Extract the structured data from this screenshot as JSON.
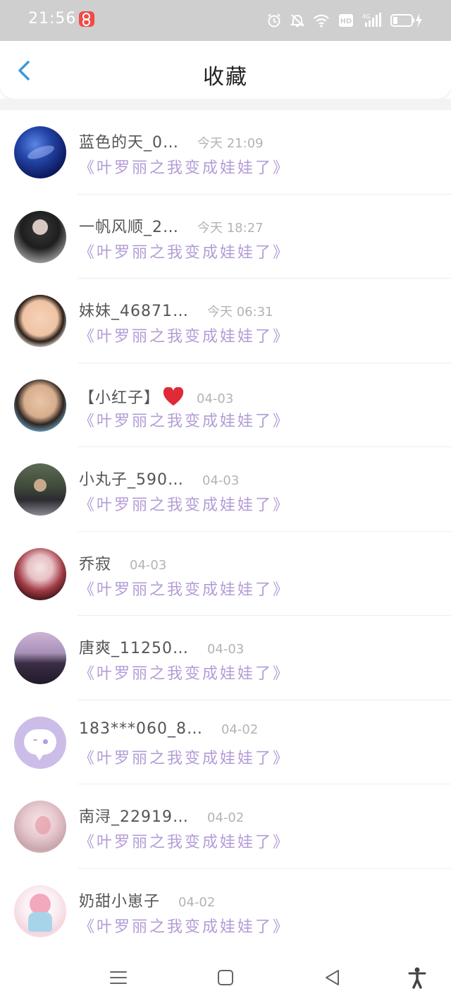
{
  "status_bar": {
    "time": "21:56",
    "icons": [
      "app-notification-icon",
      "alarm-icon",
      "mute-icon",
      "wifi-icon",
      "hd-icon",
      "signal-4g-icon",
      "battery-charging-icon"
    ],
    "network_label": "4G",
    "hd_label": "HD"
  },
  "header": {
    "title": "收藏",
    "back_icon": "chevron-left-icon",
    "accent_color": "#3a9bdc"
  },
  "items": [
    {
      "name": "蓝色的天_0…",
      "time": "今天 21:09",
      "book": "《叶罗丽之我变成娃娃了》",
      "avatar": "earth"
    },
    {
      "name": "一帆风顺_2…",
      "time": "今天 18:27",
      "book": "《叶罗丽之我变成娃娃了》",
      "avatar": "girl-dark"
    },
    {
      "name": "妹妹_46871…",
      "time": "今天 06:31",
      "book": "《叶罗丽之我变成娃娃了》",
      "avatar": "child"
    },
    {
      "name": "【小红子】",
      "time": "04-03",
      "book": "《叶罗丽之我变成娃娃了》",
      "avatar": "woman",
      "emoji": "heart-icon"
    },
    {
      "name": "小丸子_590…",
      "time": "04-03",
      "book": "《叶罗丽之我变成娃娃了》",
      "avatar": "outdoor"
    },
    {
      "name": "乔寂",
      "time": "04-03",
      "book": "《叶罗丽之我变成娃娃了》",
      "avatar": "anime"
    },
    {
      "name": "唐爽_11250…",
      "time": "04-03",
      "book": "《叶罗丽之我变成娃娃了》",
      "avatar": "silhouette"
    },
    {
      "name": "183***060_8…",
      "time": "04-02",
      "book": "《叶罗丽之我变成娃娃了》",
      "avatar": "default"
    },
    {
      "name": "南浔_22919…",
      "time": "04-02",
      "book": "《叶罗丽之我变成娃娃了》",
      "avatar": "pink"
    },
    {
      "name": "奶甜小崽子",
      "time": "04-02",
      "book": "《叶罗丽之我变成娃娃了》",
      "avatar": "chibi"
    }
  ],
  "colors": {
    "book_title": "#b39cd6",
    "name": "#555555",
    "time": "#b3b3b3",
    "heart": "#e02a38",
    "status_bar_bg": "#cfcfcf"
  },
  "nav_bar": {
    "buttons": [
      "menu-icon",
      "home-icon",
      "back-triangle-icon",
      "accessibility-icon"
    ]
  }
}
